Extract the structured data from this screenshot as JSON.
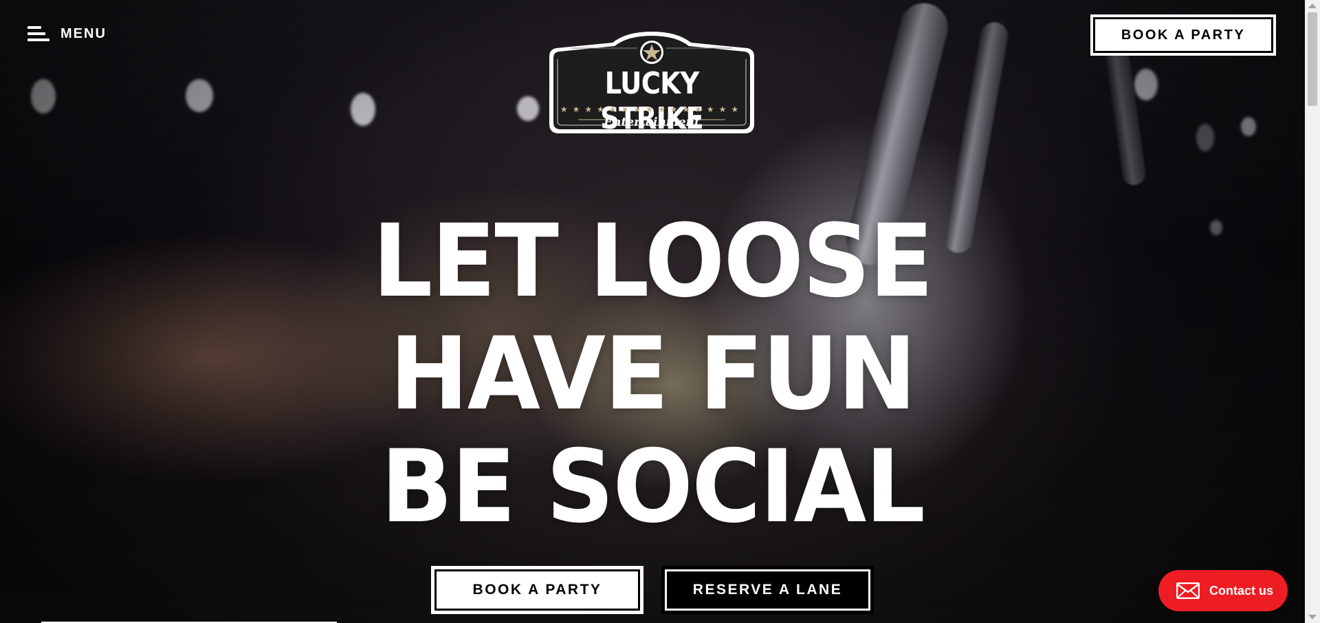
{
  "header": {
    "menu_label": "MENU",
    "book_party_label": "BOOK A PARTY"
  },
  "logo": {
    "name": "LUCKY STRIKE",
    "subtitle": "Entertainment",
    "stars": "★★★★★★★★★★★★★★★"
  },
  "hero": {
    "lines": [
      "LET LOOSE",
      "HAVE FUN",
      "BE SOCIAL"
    ],
    "book_party_label": "BOOK A PARTY",
    "reserve_lane_label": "RESERVE A LANE"
  },
  "contact": {
    "label": "Contact us",
    "color": "#ee1d24"
  }
}
